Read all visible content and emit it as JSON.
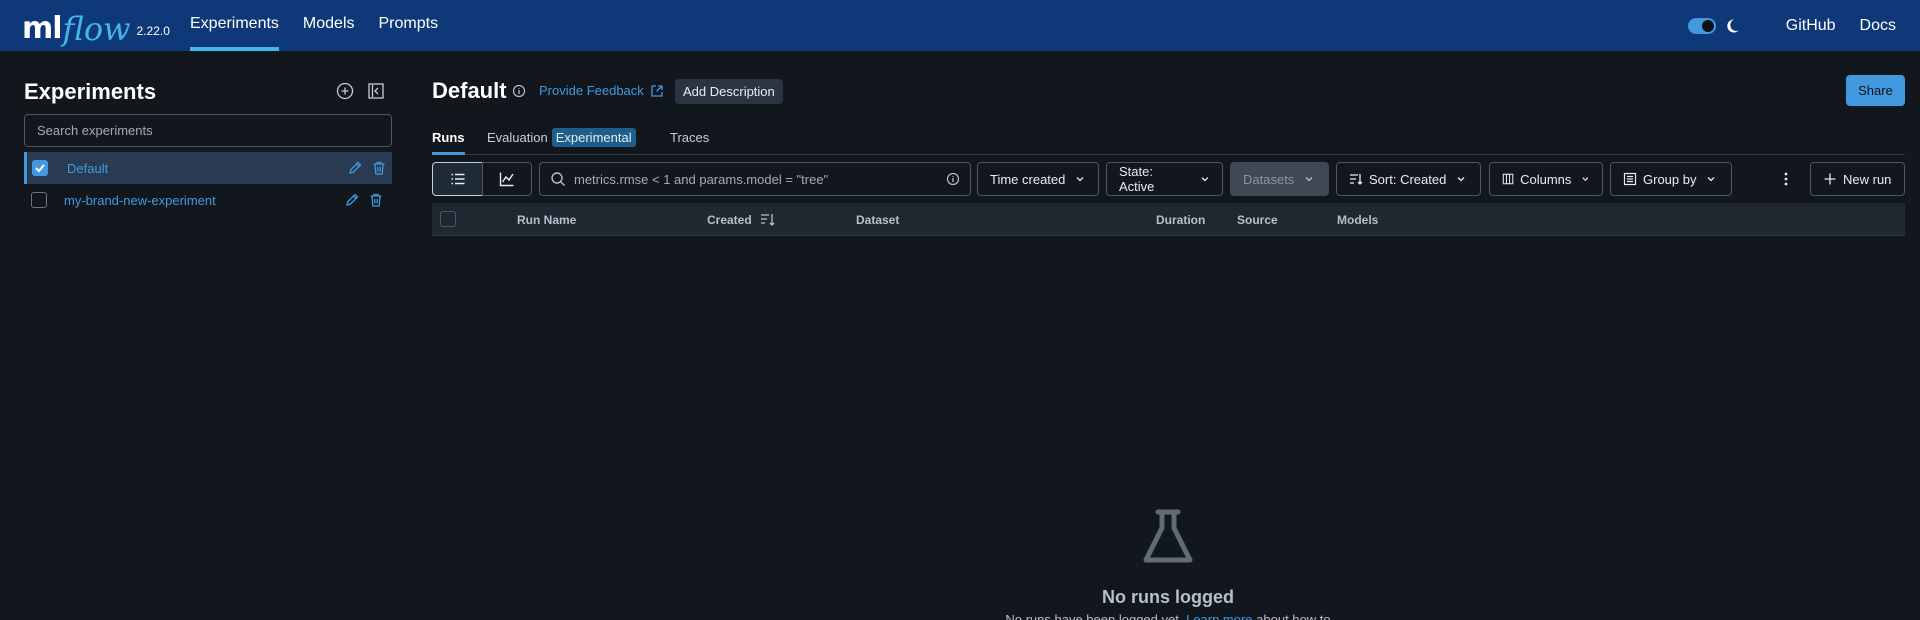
{
  "header": {
    "logo_ml": "ml",
    "logo_flow": "flow",
    "version": "2.22.0",
    "nav": [
      "Experiments",
      "Models",
      "Prompts"
    ],
    "github": "GitHub",
    "docs": "Docs",
    "dark_mode_enabled": true
  },
  "sidebar": {
    "title": "Experiments",
    "search_placeholder": "Search experiments",
    "experiments": [
      {
        "name": "Default",
        "selected": true
      },
      {
        "name": "my-brand-new-experiment",
        "selected": false
      }
    ]
  },
  "main": {
    "title": "Default",
    "feedback": "Provide Feedback",
    "add_description": "Add Description",
    "share": "Share",
    "tabs": {
      "runs": "Runs",
      "evaluation": "Evaluation",
      "evaluation_badge": "Experimental",
      "traces": "Traces"
    },
    "toolbar": {
      "filter_placeholder": "metrics.rmse < 1 and params.model = \"tree\"",
      "time_created": "Time created",
      "state": "State: Active",
      "datasets": "Datasets",
      "sort": "Sort: Created",
      "columns": "Columns",
      "group_by": "Group by",
      "new_run": "New run"
    },
    "table_headers": {
      "run_name": "Run Name",
      "created": "Created",
      "dataset": "Dataset",
      "duration": "Duration",
      "source": "Source",
      "models": "Models"
    },
    "empty": {
      "title": "No runs logged",
      "desc_prefix": "No runs have been logged yet. ",
      "learn_more": "Learn more",
      "desc_suffix": " about how to"
    }
  },
  "colors": {
    "header_bg": "#0e3877",
    "page_bg": "#11171c",
    "accent": "#4299e0",
    "logo_flow": "#43b7ec"
  }
}
